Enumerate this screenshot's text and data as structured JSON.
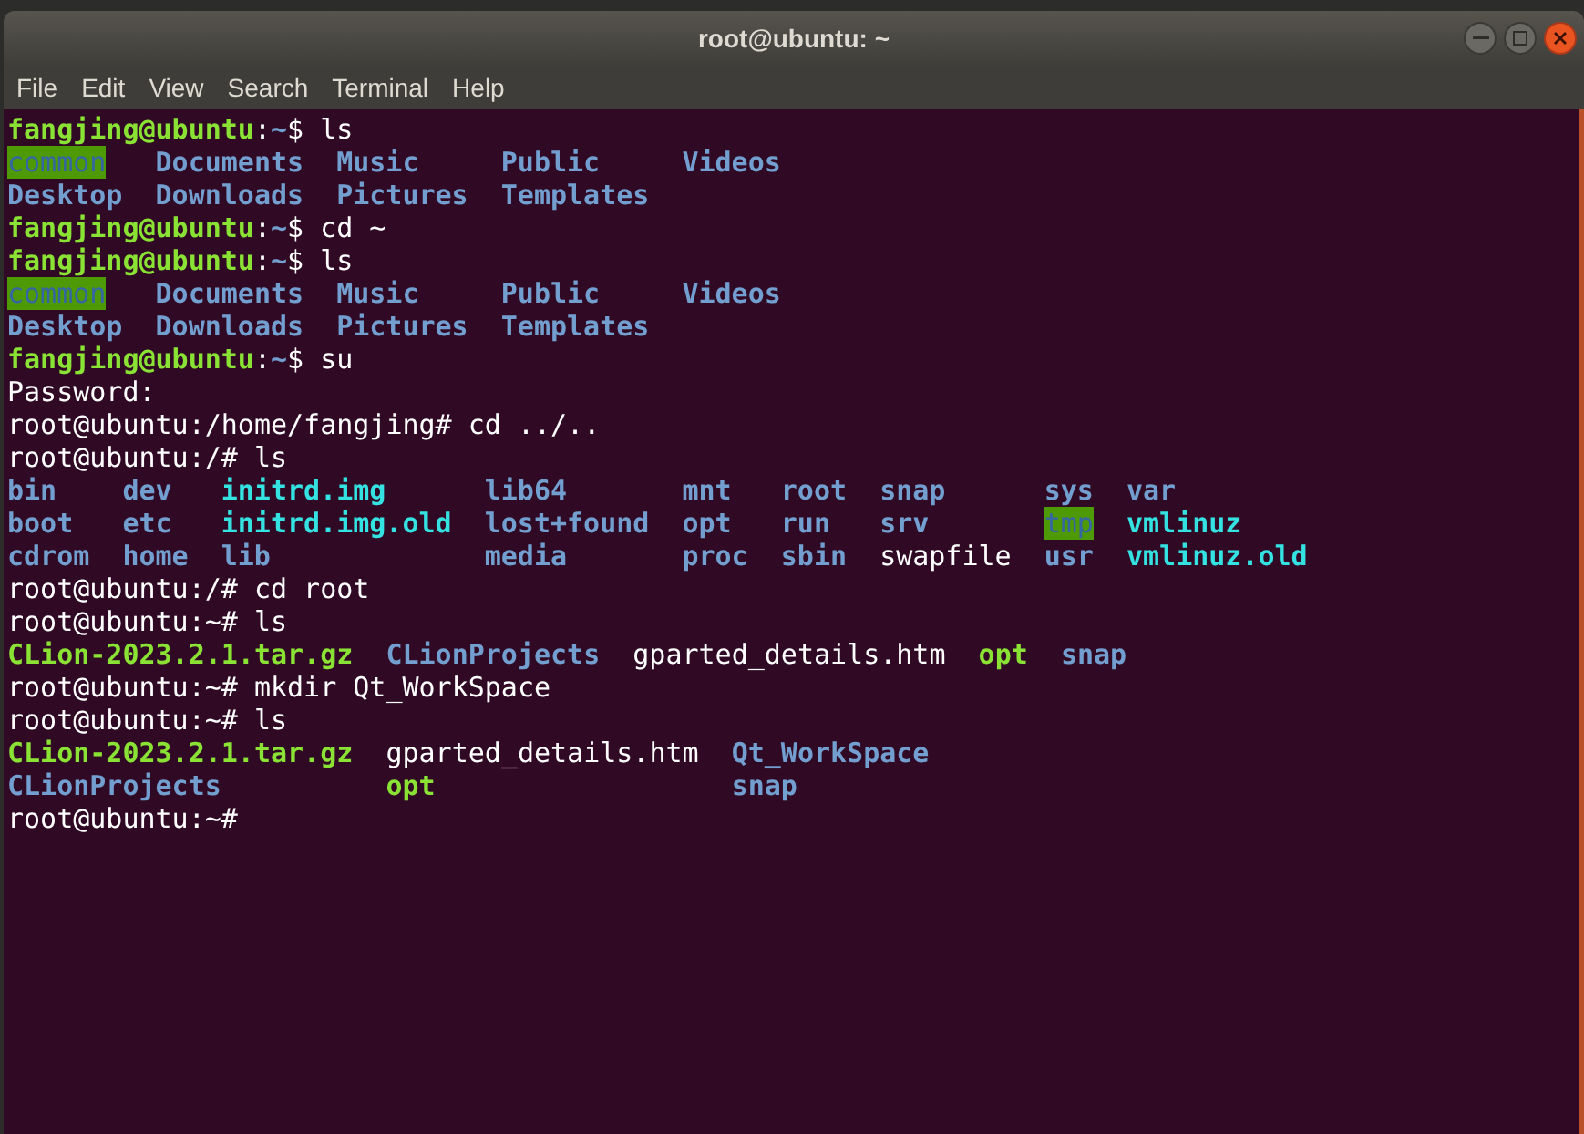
{
  "window": {
    "title": "root@ubuntu: ~"
  },
  "menu": [
    "File",
    "Edit",
    "View",
    "Search",
    "Terminal",
    "Help"
  ],
  "terminal": [
    {
      "kind": "user_prompt",
      "user_host": "fangjing@ubuntu",
      "separator": ":",
      "path": "~",
      "sigil": "$",
      "command": "ls"
    },
    {
      "kind": "listing",
      "rows": [
        [
          {
            "text": "common",
            "kind": "sticky_dir"
          },
          {
            "text": "Documents",
            "kind": "dir"
          },
          {
            "text": "Music",
            "kind": "dir"
          },
          {
            "text": "Public",
            "kind": "dir"
          },
          {
            "text": "Videos",
            "kind": "dir"
          }
        ],
        [
          {
            "text": "Desktop",
            "kind": "dir"
          },
          {
            "text": "Downloads",
            "kind": "dir"
          },
          {
            "text": "Pictures",
            "kind": "dir"
          },
          {
            "text": "Templates",
            "kind": "dir"
          }
        ]
      ]
    },
    {
      "kind": "user_prompt",
      "user_host": "fangjing@ubuntu",
      "separator": ":",
      "path": "~",
      "sigil": "$",
      "command": "cd ~"
    },
    {
      "kind": "user_prompt",
      "user_host": "fangjing@ubuntu",
      "separator": ":",
      "path": "~",
      "sigil": "$",
      "command": "ls"
    },
    {
      "kind": "listing",
      "rows": [
        [
          {
            "text": "common",
            "kind": "sticky_dir"
          },
          {
            "text": "Documents",
            "kind": "dir"
          },
          {
            "text": "Music",
            "kind": "dir"
          },
          {
            "text": "Public",
            "kind": "dir"
          },
          {
            "text": "Videos",
            "kind": "dir"
          }
        ],
        [
          {
            "text": "Desktop",
            "kind": "dir"
          },
          {
            "text": "Downloads",
            "kind": "dir"
          },
          {
            "text": "Pictures",
            "kind": "dir"
          },
          {
            "text": "Templates",
            "kind": "dir"
          }
        ]
      ]
    },
    {
      "kind": "user_prompt",
      "user_host": "fangjing@ubuntu",
      "separator": ":",
      "path": "~",
      "sigil": "$",
      "command": "su"
    },
    {
      "kind": "plain",
      "text": "Password:"
    },
    {
      "kind": "plain",
      "text": "root@ubuntu:/home/fangjing# cd ../.."
    },
    {
      "kind": "plain",
      "text": "root@ubuntu:/# ls"
    },
    {
      "kind": "listing",
      "rows": [
        [
          {
            "text": "bin",
            "kind": "dir"
          },
          {
            "text": "dev",
            "kind": "dir"
          },
          {
            "text": "initrd.img",
            "kind": "link"
          },
          {
            "text": "lib64",
            "kind": "dir"
          },
          {
            "text": "mnt",
            "kind": "dir"
          },
          {
            "text": "root",
            "kind": "dir"
          },
          {
            "text": "snap",
            "kind": "dir"
          },
          {
            "text": "sys",
            "kind": "dir"
          },
          {
            "text": "var",
            "kind": "dir"
          }
        ],
        [
          {
            "text": "boot",
            "kind": "dir"
          },
          {
            "text": "etc",
            "kind": "dir"
          },
          {
            "text": "initrd.img.old",
            "kind": "link"
          },
          {
            "text": "lost+found",
            "kind": "dir"
          },
          {
            "text": "opt",
            "kind": "dir"
          },
          {
            "text": "run",
            "kind": "dir"
          },
          {
            "text": "srv",
            "kind": "dir"
          },
          {
            "text": "tmp",
            "kind": "sticky_dir"
          },
          {
            "text": "vmlinuz",
            "kind": "link"
          }
        ],
        [
          {
            "text": "cdrom",
            "kind": "dir"
          },
          {
            "text": "home",
            "kind": "dir"
          },
          {
            "text": "lib",
            "kind": "dir"
          },
          {
            "text": "media",
            "kind": "dir"
          },
          {
            "text": "proc",
            "kind": "dir"
          },
          {
            "text": "sbin",
            "kind": "dir"
          },
          {
            "text": "swapfile",
            "kind": "file"
          },
          {
            "text": "usr",
            "kind": "dir"
          },
          {
            "text": "vmlinuz.old",
            "kind": "link"
          }
        ]
      ]
    },
    {
      "kind": "plain",
      "text": "root@ubuntu:/# cd root"
    },
    {
      "kind": "plain",
      "text": "root@ubuntu:~# ls"
    },
    {
      "kind": "listing",
      "rows": [
        [
          {
            "text": "CLion-2023.2.1.tar.gz",
            "kind": "exec"
          },
          {
            "text": "CLionProjects",
            "kind": "dir"
          },
          {
            "text": "gparted_details.htm",
            "kind": "file"
          },
          {
            "text": "opt",
            "kind": "exec"
          },
          {
            "text": "snap",
            "kind": "dir"
          }
        ]
      ]
    },
    {
      "kind": "plain",
      "text": "root@ubuntu:~# mkdir Qt_WorkSpace"
    },
    {
      "kind": "plain",
      "text": "root@ubuntu:~# ls"
    },
    {
      "kind": "listing",
      "rows": [
        [
          {
            "text": "CLion-2023.2.1.tar.gz",
            "kind": "exec"
          },
          {
            "text": "gparted_details.htm",
            "kind": "file"
          },
          {
            "text": "Qt_WorkSpace",
            "kind": "dir"
          }
        ],
        [
          {
            "text": "CLionProjects",
            "kind": "dir"
          },
          {
            "text": "opt",
            "kind": "exec"
          },
          {
            "text": "snap",
            "kind": "dir"
          }
        ]
      ]
    },
    {
      "kind": "plain",
      "text": "root@ubuntu:~#"
    }
  ]
}
